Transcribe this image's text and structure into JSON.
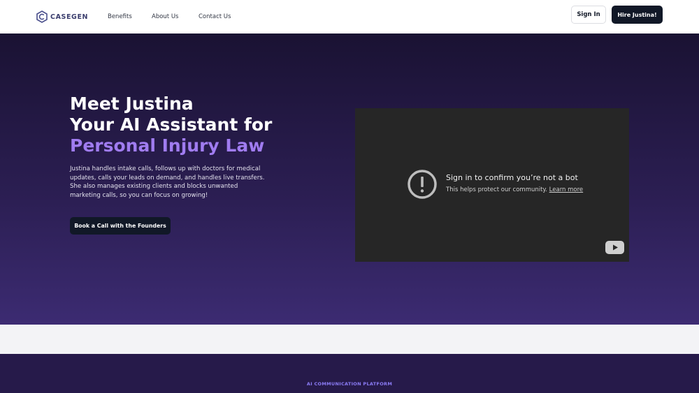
{
  "header": {
    "logo_text": "CASEGEN",
    "nav": [
      "Benefits",
      "About Us",
      "Contact Us"
    ],
    "signin_label": "Sign In",
    "hire_label": "Hire Justina!"
  },
  "hero": {
    "title_line1": "Meet Justina",
    "title_line2": "Your AI Assistant for",
    "title_line3": "Personal Injury Law",
    "description": "Justina handles intake calls, follows up with doctors for medical updates, calls your leads on demand, and handles live transfers. She also manages existing clients and blocks unwanted marketing calls, so you can focus on growing!",
    "cta_label": "Book a Call with the Founders",
    "video": {
      "title": "Sign in to confirm you’re not a bot",
      "subtitle": "This helps protect our community.",
      "link": "Learn more"
    }
  },
  "section2": {
    "eyebrow": "AI COMMUNICATION PLATFORM"
  },
  "colors": {
    "hero_top": "#1a1233",
    "hero_bottom": "#3c2b72",
    "accent": "#a07cf0",
    "button_dark": "#111827",
    "eyebrow": "#8b7cf6"
  },
  "icons": [
    "casegen-logo-icon",
    "alert-icon",
    "youtube-icon"
  ]
}
